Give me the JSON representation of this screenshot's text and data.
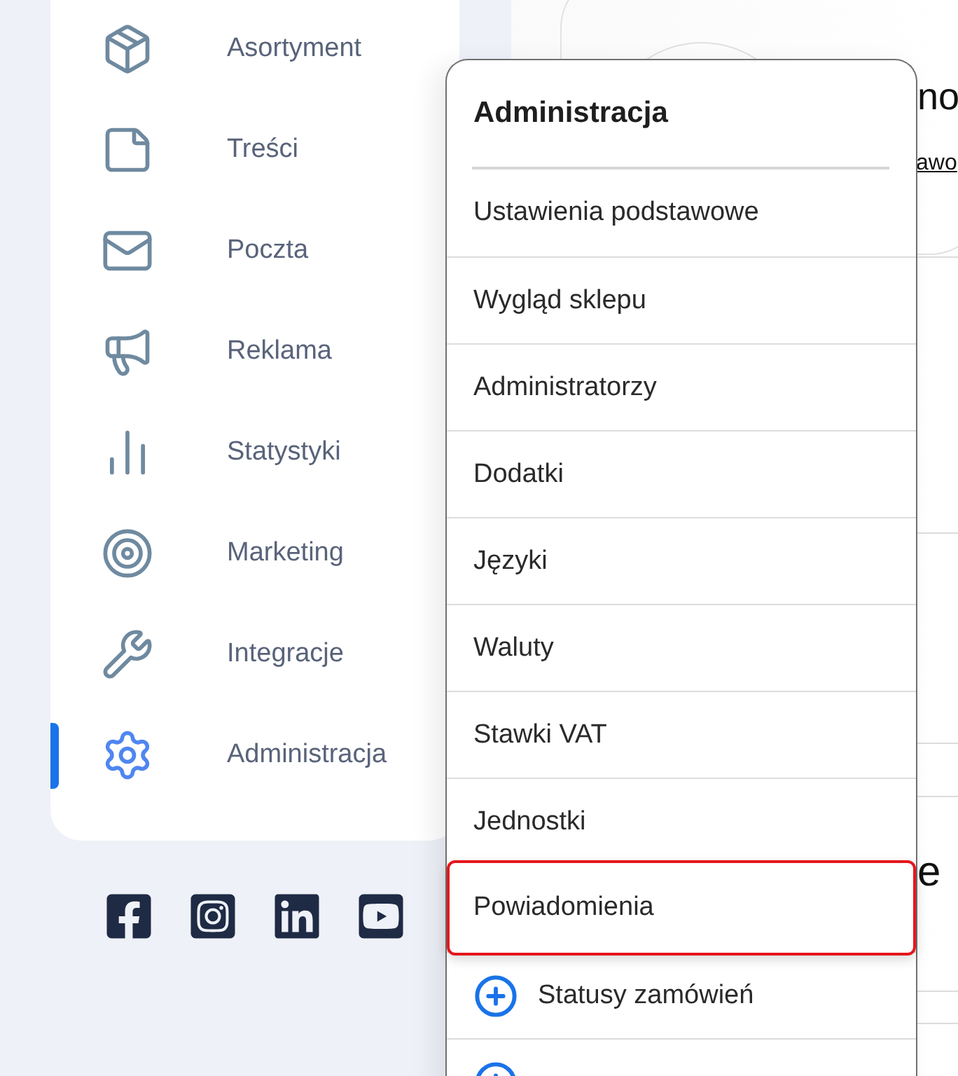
{
  "sidebar": {
    "items": [
      {
        "label": "Asortyment",
        "selected": false
      },
      {
        "label": "Treści",
        "selected": false
      },
      {
        "label": "Poczta",
        "selected": false
      },
      {
        "label": "Reklama",
        "selected": false
      },
      {
        "label": "Statystyki",
        "selected": false
      },
      {
        "label": "Marketing",
        "selected": false
      },
      {
        "label": "Integracje",
        "selected": false
      },
      {
        "label": "Administracja",
        "selected": true
      }
    ]
  },
  "background": {
    "heading_fragment": "no",
    "link_fragment": "awo",
    "fragment_3": "e"
  },
  "menu": {
    "title": "Administracja",
    "items": [
      {
        "label": "Ustawienia podstawowe",
        "kind": "plain",
        "selected": false
      },
      {
        "label": "Wygląd sklepu",
        "kind": "plain",
        "selected": false
      },
      {
        "label": "Administratorzy",
        "kind": "plain",
        "selected": false
      },
      {
        "label": "Dodatki",
        "kind": "plain",
        "selected": false
      },
      {
        "label": "Języki",
        "kind": "plain",
        "selected": false
      },
      {
        "label": "Waluty",
        "kind": "plain",
        "selected": false
      },
      {
        "label": "Stawki VAT",
        "kind": "plain",
        "selected": false
      },
      {
        "label": "Jednostki",
        "kind": "plain",
        "selected": false
      },
      {
        "label": "Powiadomienia",
        "kind": "plain",
        "selected": true
      },
      {
        "label": "Statusy zamówień",
        "kind": "add",
        "selected": false
      },
      {
        "kind": "add",
        "selected": false
      }
    ]
  }
}
